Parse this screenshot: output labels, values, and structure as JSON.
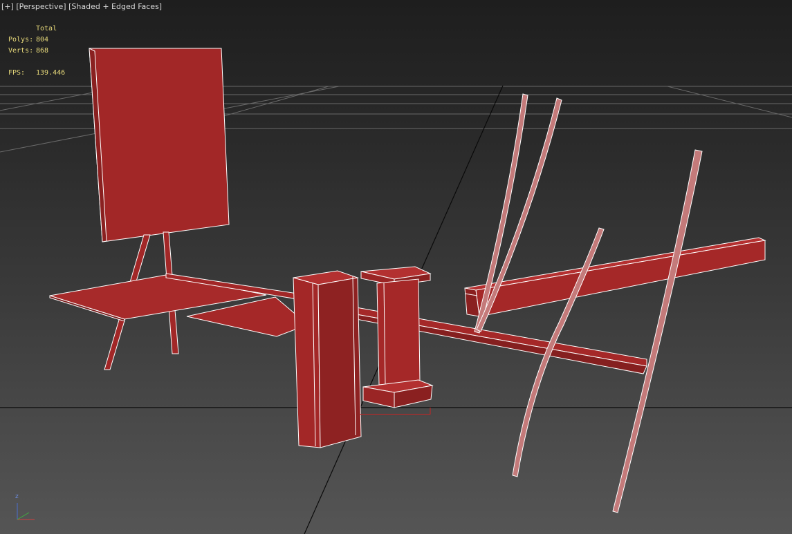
{
  "viewport": {
    "label_plus": "[+]",
    "label_view": "[Perspective]",
    "label_shading": "[Shaded + Edged Faces]"
  },
  "stats": {
    "header": "Total",
    "polys_label": "Polys:",
    "polys_value": "804",
    "verts_label": "Verts:",
    "verts_value": "868",
    "fps_label": "FPS:",
    "fps_value": "139.446"
  },
  "gizmo": {
    "z_label": "z"
  },
  "colors": {
    "object_fill": "#a02626",
    "object_shade": "#7f1d1d",
    "edge": "#ffffff",
    "grid": "#8a8a8a",
    "axis": "#0b0b0b",
    "stats_text": "#e7d97a"
  }
}
